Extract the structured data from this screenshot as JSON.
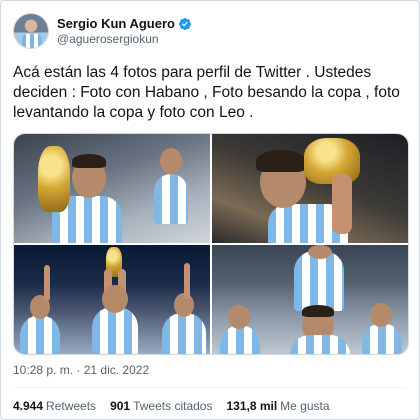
{
  "author": {
    "display_name": "Sergio Kun Aguero",
    "handle": "@aguerosergiokun",
    "verified": true,
    "verified_color": "#1d9bf0"
  },
  "tweet": {
    "text": "Acá están las 4 fotos para perfil de Twitter . Ustedes deciden : Foto con Habano , Foto besando la copa , foto levantando la copa y foto con Leo .",
    "time": "10:28 p. m.",
    "separator": "·",
    "date": "21 dic. 2022"
  },
  "media": {
    "photos": [
      {
        "icon": "photo-with-cigar-and-trophy"
      },
      {
        "icon": "photo-kissing-trophy"
      },
      {
        "icon": "photo-lifting-trophy"
      },
      {
        "icon": "photo-with-leo"
      }
    ]
  },
  "stats": {
    "retweets_value": "4.944",
    "retweets_label": "Retweets",
    "quotes_value": "901",
    "quotes_label": "Tweets citados",
    "likes_value": "131,8 mil",
    "likes_label": "Me gusta"
  }
}
